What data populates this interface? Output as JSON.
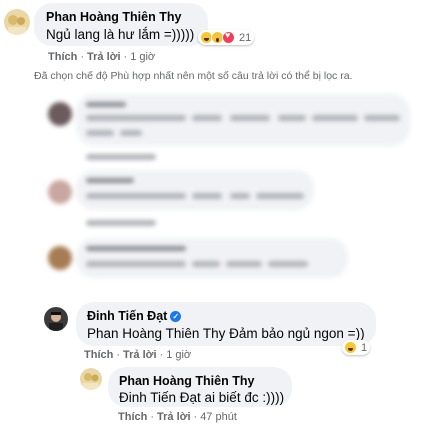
{
  "comment1": {
    "author": "Phan Hoàng Thiên Thy",
    "text": "Ngủ lang là hư lắm =)))))",
    "reaction_icons": [
      "haha-icon",
      "wow-icon",
      "love-icon"
    ],
    "reaction_count": "21",
    "action_like": "Thích",
    "action_reply": "Trả lời",
    "time": "1 giờ"
  },
  "notice": "Đã chọn chế độ Phù hợp nhất nên một số câu trả lời có thể bị lọc ra.",
  "comment2": {
    "author": "Đinh Tiến Đạt",
    "text": "Phan Hoàng Thiên Thy Đảm bảo ngủ ngon =))",
    "reaction_icons": [
      "haha-icon"
    ],
    "reaction_count": "1",
    "action_like": "Thích",
    "action_reply": "Trả lời",
    "time": "1 giờ"
  },
  "comment3": {
    "author": "Phan Hoàng Thiên Thy",
    "text": "Đinh Tiến Đạt ai biết đc :))))",
    "action_like": "Thích",
    "action_reply": "Trả lời",
    "time": "47 phút"
  },
  "colors": {
    "bubble": "#f0f2f5",
    "secondary_text": "#65676b",
    "verified": "#1877f2"
  }
}
